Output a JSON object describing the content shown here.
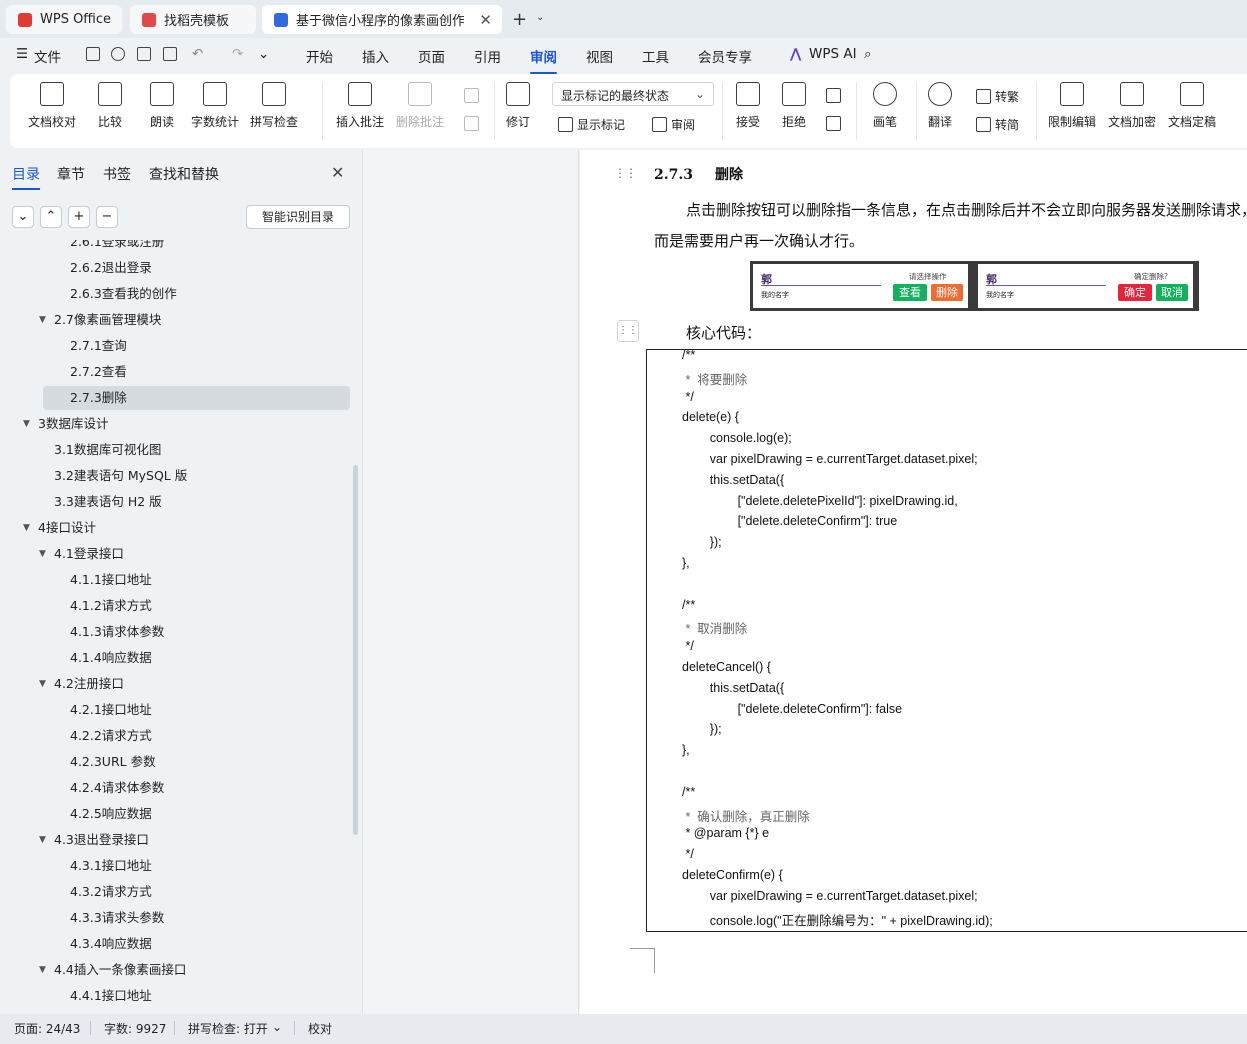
{
  "tabs": [
    {
      "label": "WPS Office",
      "color": "#e03c31"
    },
    {
      "label": "找稻壳模板",
      "color": "#e04a4a"
    },
    {
      "label": "基于微信小程序的像素画创作与",
      "color": "#2f6bdc"
    }
  ],
  "menu": {
    "file": "文件",
    "items": [
      "开始",
      "插入",
      "页面",
      "引用",
      "审阅",
      "视图",
      "工具",
      "会员专享"
    ],
    "active": "审阅",
    "wps_ai": "WPS AI"
  },
  "ribbon": {
    "doc_proofread": "文档校对",
    "compare": "比较",
    "read_aloud": "朗读",
    "word_count": "字数统计",
    "spell_check": "拼写检查",
    "insert_comment": "插入批注",
    "delete_comment": "删除批注",
    "track": "修订",
    "markup_select": "显示标记的最终状态",
    "show_markup": "显示标记",
    "review": "审阅",
    "accept": "接受",
    "reject": "拒绝",
    "pen": "画笔",
    "translate": "翻译",
    "to_traditional": "转繁",
    "to_simplified": "转简",
    "restrict_edit": "限制编辑",
    "encrypt": "文档加密",
    "finalize": "文档定稿"
  },
  "sidebar": {
    "tabs": [
      "目录",
      "章节",
      "书签",
      "查找和替换"
    ],
    "smart_btn": "智能识别目录",
    "toc": [
      {
        "text": "2.6.1登录或注册",
        "level": 3
      },
      {
        "text": "2.6.2退出登录",
        "level": 3
      },
      {
        "text": "2.6.3查看我的创作",
        "level": 3
      },
      {
        "text": "2.7像素画管理模块",
        "level": 2,
        "expanded": true
      },
      {
        "text": "2.7.1查询",
        "level": 3
      },
      {
        "text": "2.7.2查看",
        "level": 3
      },
      {
        "text": "2.7.3删除",
        "level": 3,
        "selected": true
      },
      {
        "text": "3数据库设计",
        "level": 1,
        "expanded": true
      },
      {
        "text": "3.1数据库可视化图",
        "level": 2
      },
      {
        "text": "3.2建表语句 MySQL 版",
        "level": 2
      },
      {
        "text": "3.3建表语句 H2 版",
        "level": 2
      },
      {
        "text": "4接口设计",
        "level": 1,
        "expanded": true
      },
      {
        "text": "4.1登录接口",
        "level": 2,
        "expanded": true
      },
      {
        "text": "4.1.1接口地址",
        "level": 3
      },
      {
        "text": "4.1.2请求方式",
        "level": 3
      },
      {
        "text": "4.1.3请求体参数",
        "level": 3
      },
      {
        "text": "4.1.4响应数据",
        "level": 3
      },
      {
        "text": "4.2注册接口",
        "level": 2,
        "expanded": true
      },
      {
        "text": "4.2.1接口地址",
        "level": 3
      },
      {
        "text": "4.2.2请求方式",
        "level": 3
      },
      {
        "text": "4.2.3URL 参数",
        "level": 3
      },
      {
        "text": "4.2.4请求体参数",
        "level": 3
      },
      {
        "text": "4.2.5响应数据",
        "level": 3
      },
      {
        "text": "4.3退出登录接口",
        "level": 2,
        "expanded": true
      },
      {
        "text": "4.3.1接口地址",
        "level": 3
      },
      {
        "text": "4.3.2请求方式",
        "level": 3
      },
      {
        "text": "4.3.3请求头参数",
        "level": 3
      },
      {
        "text": "4.3.4响应数据",
        "level": 3
      },
      {
        "text": "4.4插入一条像素画接口",
        "level": 2,
        "expanded": true
      },
      {
        "text": "4.4.1接口地址",
        "level": 3
      }
    ]
  },
  "doc": {
    "heading_num": "2.7.3",
    "heading_text": "删除",
    "para1": "点击删除按钮可以删除指一条信息，在点击删除后并不会立即向服务器发送删除请求，",
    "para2": "而是需要用户再一次确认才行。",
    "screenshot": {
      "left": {
        "name": "郭",
        "sub": "我的名字",
        "hint": "请选择操作",
        "btn1": "查看",
        "btn2": "删除"
      },
      "right": {
        "name": "郭",
        "sub": "我的名字",
        "hint": "确定删除?",
        "btn1": "确定",
        "btn2": "取消"
      }
    },
    "core_label": "核心代码：",
    "code_lines": [
      "/**",
      " *  将要删除",
      " */",
      "delete(e) {",
      "        console.log(e);",
      "        var pixelDrawing = e.currentTarget.dataset.pixel;",
      "        this.setData({",
      "                [\"delete.deletePixelId\"]: pixelDrawing.id,",
      "                [\"delete.deleteConfirm\"]: true",
      "        });",
      "},",
      "",
      "/**",
      " *  取消删除",
      " */",
      "deleteCancel() {",
      "        this.setData({",
      "                [\"delete.deleteConfirm\"]: false",
      "        });",
      "},",
      "",
      "/**",
      " *  确认删除，真正删除",
      " * @param {*} e",
      " */",
      "deleteConfirm(e) {",
      "        var pixelDrawing = e.currentTarget.dataset.pixel;",
      "        console.log(\"正在删除编号为：\" + pixelDrawing.id);"
    ]
  },
  "status": {
    "page": "页面: 24/43",
    "words": "字数: 9927",
    "spell": "拼写检查: 打开",
    "proof": "校对"
  }
}
